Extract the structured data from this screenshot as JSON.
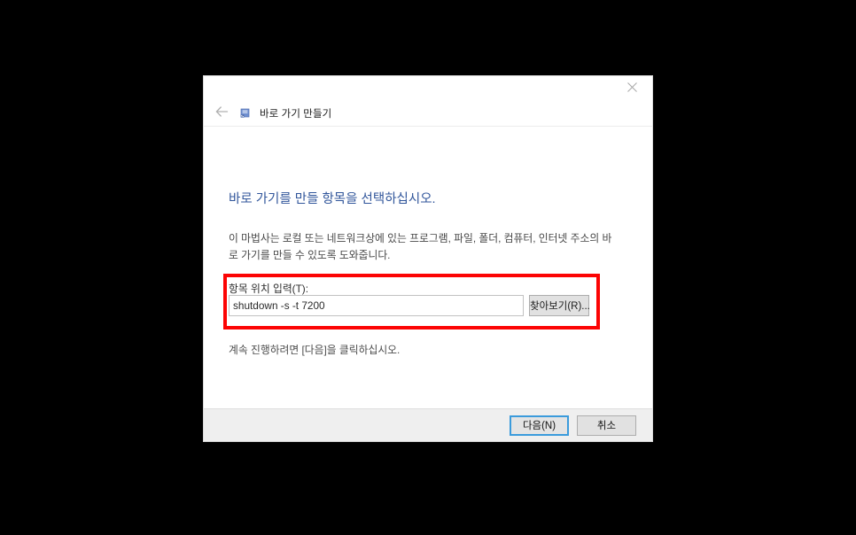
{
  "window": {
    "nav_title": "바로 가기 만들기",
    "close_label": "닫기",
    "back_label": "뒤로",
    "icons": {
      "close": "close-icon",
      "back": "back-arrow-icon",
      "app": "shortcut-icon"
    }
  },
  "content": {
    "heading": "바로 가기를 만들 항목을 선택하십시오.",
    "description": "이 마법사는 로컬 또는 네트워크상에 있는 프로그램, 파일, 폴더, 컴퓨터, 인터넷 주소의 바로 가기를 만들 수 있도록 도와줍니다.",
    "field_label": "항목 위치 입력(T):",
    "location_value": "shutdown -s -t 7200",
    "location_placeholder": "",
    "browse_label": "찾아보기(R)...",
    "continue_text": "계속 진행하려면 [다음]을 클릭하십시오."
  },
  "footer": {
    "next_label": "다음(N)",
    "cancel_label": "취소"
  },
  "colors": {
    "heading_blue": "#31569b",
    "annotation_red": "#fc0404",
    "focus_blue": "#3b9bdc",
    "backdrop": "#000000",
    "dialog_bg": "#ffffff",
    "footer_bg": "#efefef"
  }
}
